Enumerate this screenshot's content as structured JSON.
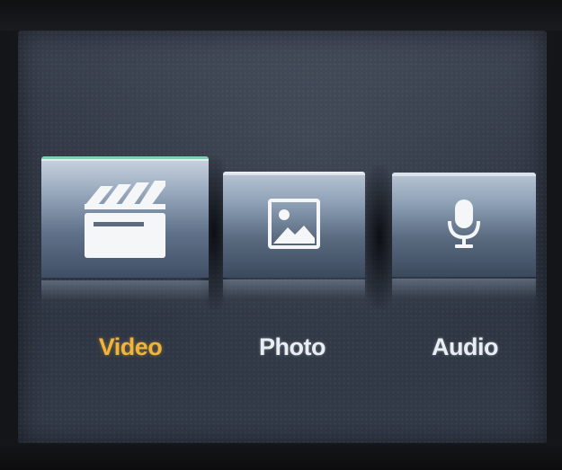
{
  "menu": {
    "items": [
      {
        "label": "Video",
        "icon": "clapperboard-icon",
        "selected": true
      },
      {
        "label": "Photo",
        "icon": "picture-icon",
        "selected": false
      },
      {
        "label": "Audio",
        "icon": "microphone-icon",
        "selected": false
      }
    ]
  },
  "colors": {
    "selected_label": "#f0b43a",
    "label": "#e9eef4",
    "screen_bg": "#2c333f"
  }
}
